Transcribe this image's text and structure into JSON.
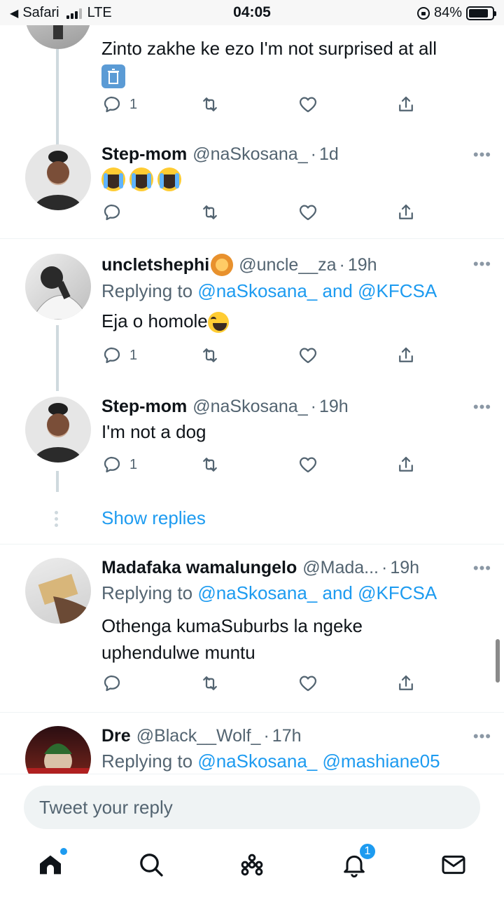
{
  "status_bar": {
    "back_app": "Safari",
    "network": "LTE",
    "time": "04:05",
    "battery": "84%",
    "battery_level": 0.84
  },
  "tweets": [
    {
      "text": "Zinto zakhe ke ezo I'm not surprised at all",
      "reply_count": "1"
    },
    {
      "name": "Step-mom",
      "handle": "@naSkosana_",
      "time": "1d",
      "reply_count": ""
    },
    {
      "name": "uncletshephi",
      "handle": "@uncle__za",
      "time": "19h",
      "replying_prefix": "Replying to",
      "mention1": "@naSkosana_",
      "joiner": "and",
      "mention2": "@KFCSA",
      "text": "Eja o homole",
      "reply_count": "1"
    },
    {
      "name": "Step-mom",
      "handle": "@naSkosana_",
      "time": "19h",
      "text": "I'm not a dog",
      "reply_count": "1"
    },
    {
      "name": "Madafaka wamalungelo",
      "handle": "@Mada...",
      "time": "19h",
      "replying_prefix": "Replying to",
      "mention1": "@naSkosana_",
      "joiner": "and",
      "mention2": "@KFCSA",
      "text_line1": "Othenga kumaSuburbs la ngeke",
      "text_line2": "uphendulwe muntu",
      "reply_count": ""
    },
    {
      "name": "Dre",
      "handle": "@Black__Wolf_",
      "time": "17h",
      "replying_prefix": "Replying to",
      "mention1": "@naSkosana_",
      "mention2": "@mashiane05"
    }
  ],
  "show_replies": "Show replies",
  "more_glyph": "•••",
  "separator": "·",
  "reply_box": {
    "placeholder": "Tweet your reply"
  },
  "tab_bar": {
    "items": [
      "home-icon",
      "search-icon",
      "spaces-icon",
      "notifications-icon",
      "messages-icon"
    ],
    "notifications_badge": "1"
  },
  "colors": {
    "accent": "#1d9bf0",
    "text": "#0f1419",
    "secondary": "#536471"
  }
}
